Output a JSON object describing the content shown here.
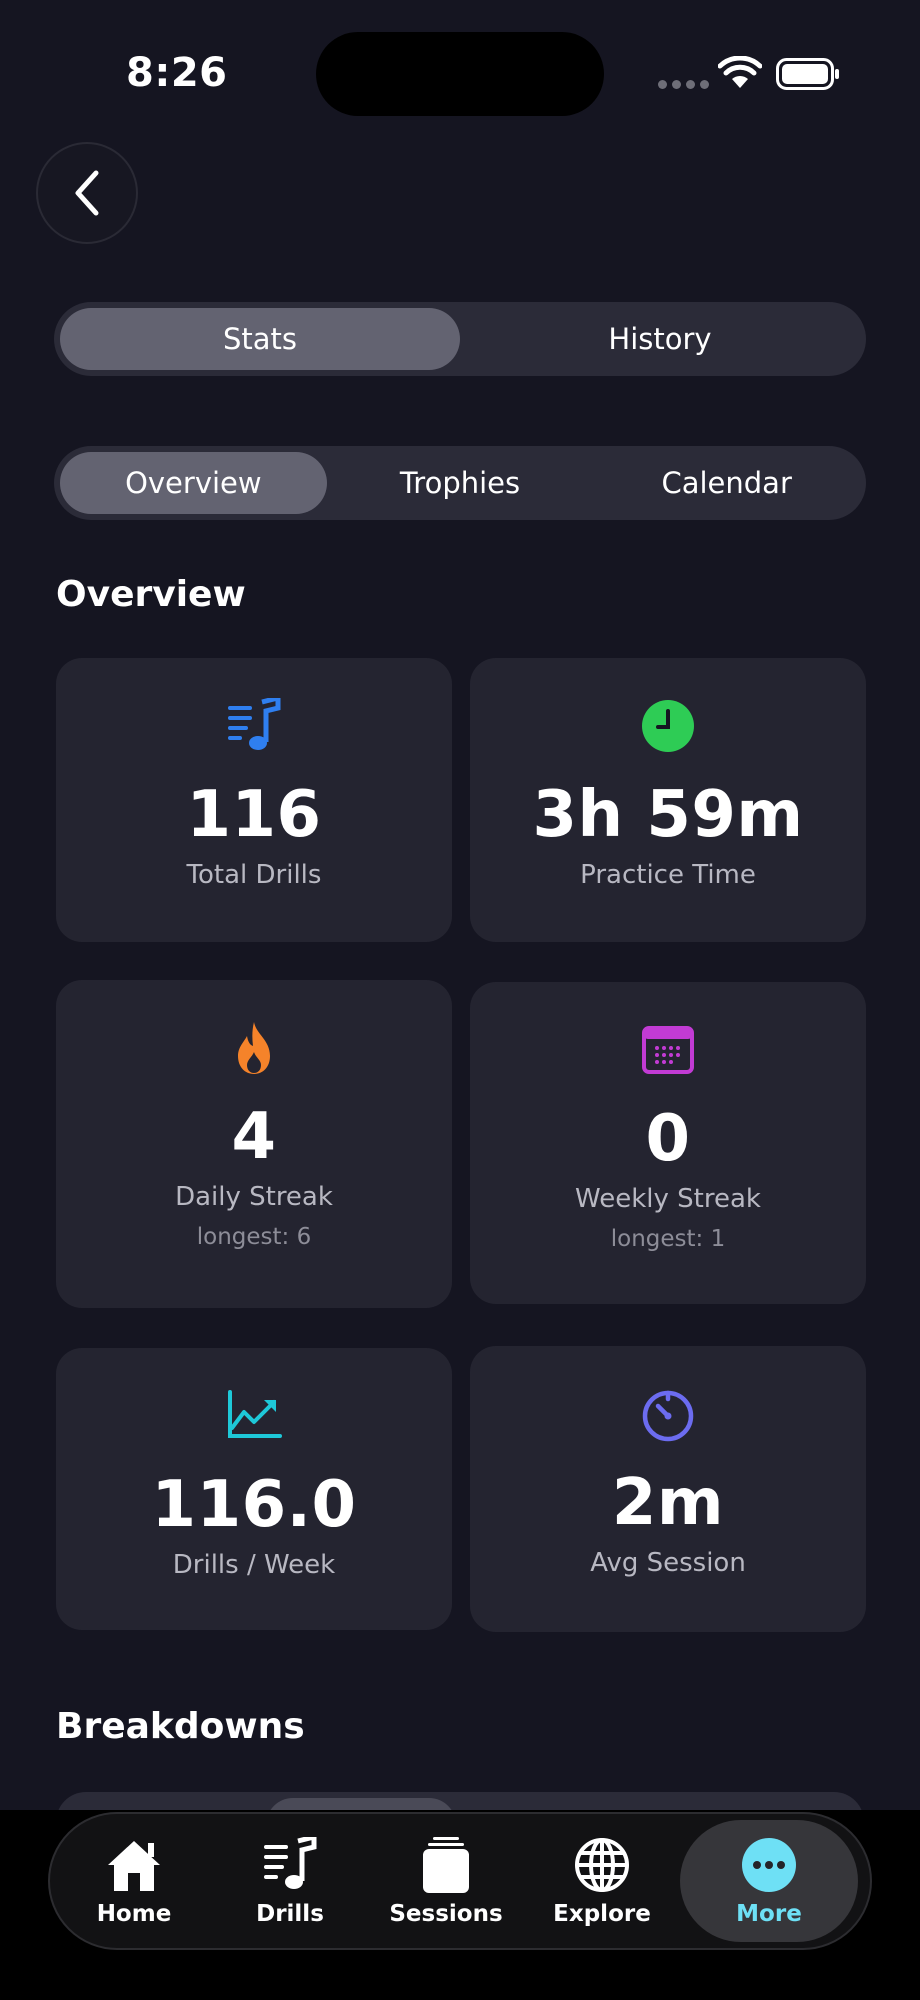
{
  "status_bar": {
    "time": "8:26"
  },
  "segments": {
    "top": [
      "Stats",
      "History"
    ],
    "sub": [
      "Overview",
      "Trophies",
      "Calendar"
    ]
  },
  "sections": {
    "overview": "Overview",
    "breakdowns": "Breakdowns"
  },
  "cards": {
    "total_drills": {
      "value": "116",
      "label": "Total Drills"
    },
    "practice_time": {
      "value": "3h 59m",
      "label": "Practice Time"
    },
    "daily_streak": {
      "value": "4",
      "label": "Daily Streak",
      "sub": "longest: 6"
    },
    "weekly_streak": {
      "value": "0",
      "label": "Weekly Streak",
      "sub": "longest: 1"
    },
    "drills_per_week": {
      "value": "116.0",
      "label": "Drills / Week"
    },
    "avg_session": {
      "value": "2m",
      "label": "Avg Session"
    }
  },
  "icons": {
    "total_drills": "music-list-icon",
    "practice_time": "clock-icon",
    "daily_streak": "flame-icon",
    "weekly_streak": "calendar-icon",
    "drills_per_week": "trend-chart-icon",
    "avg_session": "timer-icon"
  },
  "colors": {
    "blue": "#2f7ff0",
    "green": "#2ecc55",
    "orange": "#f5832a",
    "magenta": "#c23bd4",
    "cyan": "#1ec8d8",
    "indigo": "#6c6cf0",
    "active_tab": "#6ee0f5"
  },
  "tabbar": {
    "items": [
      "Home",
      "Drills",
      "Sessions",
      "Explore",
      "More"
    ],
    "active": "More"
  }
}
